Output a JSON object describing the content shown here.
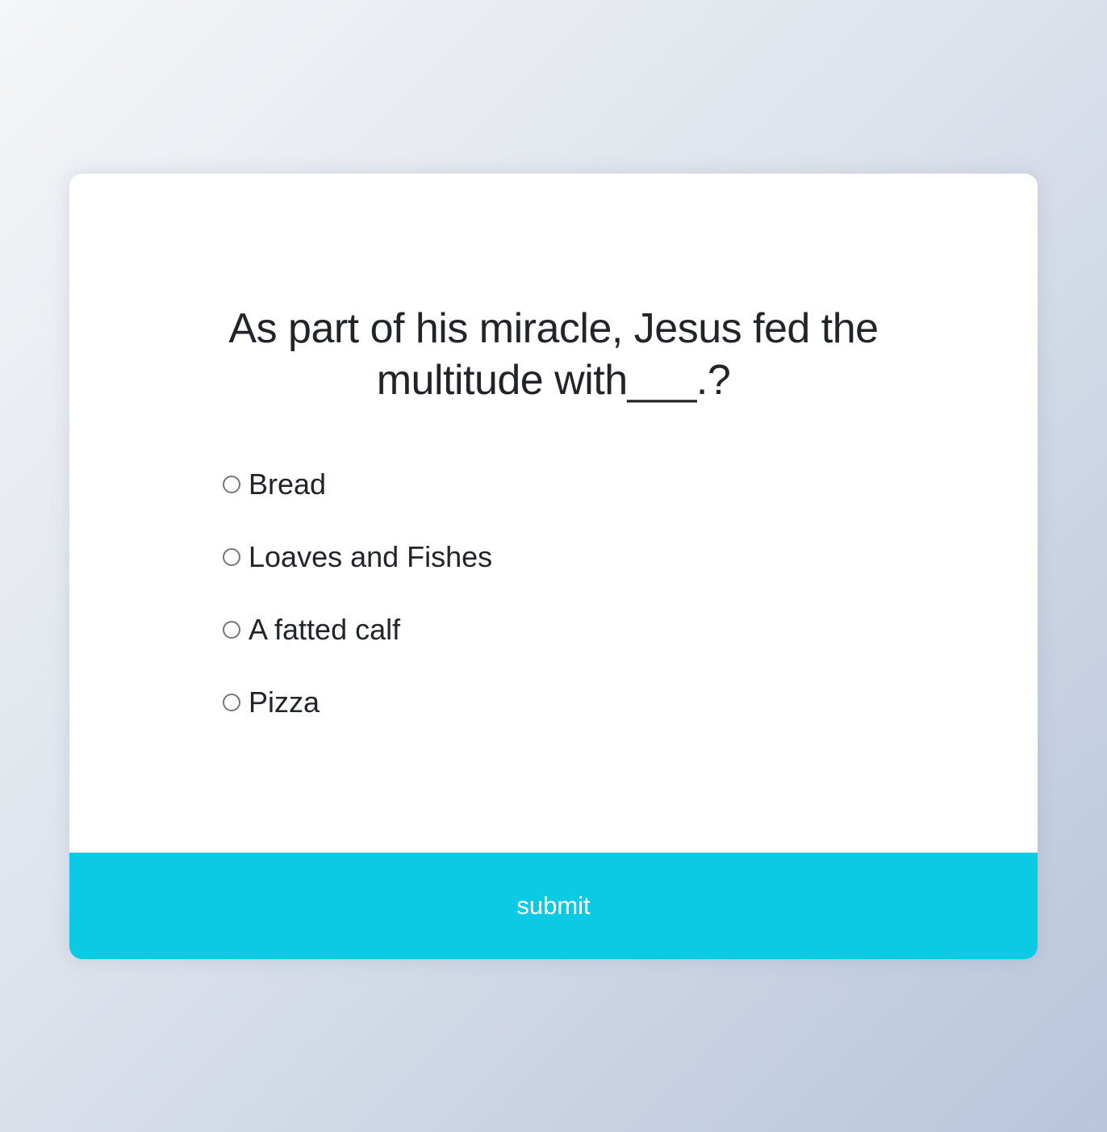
{
  "quiz": {
    "question": "As part of his miracle, Jesus fed the multitude with___.?",
    "answers": [
      {
        "label": "Bread"
      },
      {
        "label": "Loaves and Fishes"
      },
      {
        "label": "A fatted calf"
      },
      {
        "label": "Pizza"
      }
    ],
    "submit_label": "submit"
  },
  "colors": {
    "accent": "#0acbe3",
    "text": "#212529",
    "card_background": "#ffffff"
  }
}
